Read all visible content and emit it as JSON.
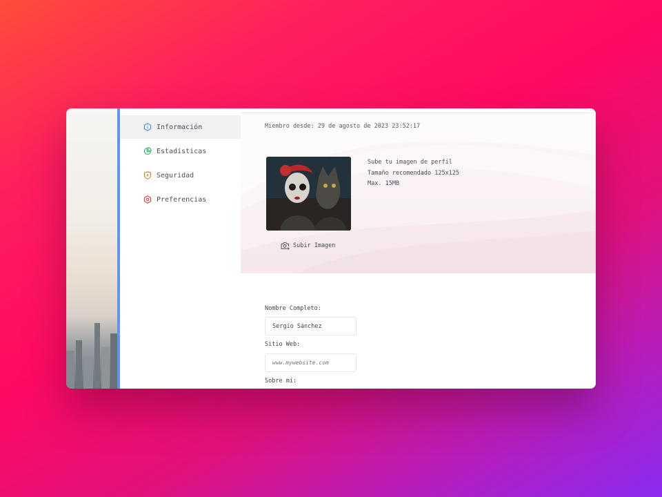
{
  "sidebar": {
    "items": [
      {
        "label": "Información",
        "icon": "info-icon",
        "active": true,
        "color": "#3d8ddf"
      },
      {
        "label": "Estadísticas",
        "icon": "pie-chart-icon",
        "active": false,
        "color": "#2fb36a"
      },
      {
        "label": "Seguridad",
        "icon": "shield-icon",
        "active": false,
        "color": "#d0822a"
      },
      {
        "label": "Preferencias",
        "icon": "settings-icon",
        "active": false,
        "color": "#d23c3c"
      }
    ]
  },
  "main": {
    "member_since": "Miembro desde: 29 de agosto de 2023 23:52:17",
    "upload": {
      "title": "Sube tu imagen de perfil",
      "recommended": "Tamaño recomendado 125x125",
      "max": "Max. 15MB",
      "button_label": "Subir Imagen",
      "button_icon": "camera-plus-icon"
    },
    "form": {
      "name_label": "Nombre Completo:",
      "name_value": "Sergio Sánchez",
      "website_label": "Sitio Web:",
      "website_placeholder": "www.mywebsite.com",
      "about_label": "Sobre mí:"
    }
  },
  "colors": {
    "accent": "#5d97ea",
    "background_gradient": [
      "#ff4d3a",
      "#ff0a63",
      "#8a2bf0"
    ]
  }
}
